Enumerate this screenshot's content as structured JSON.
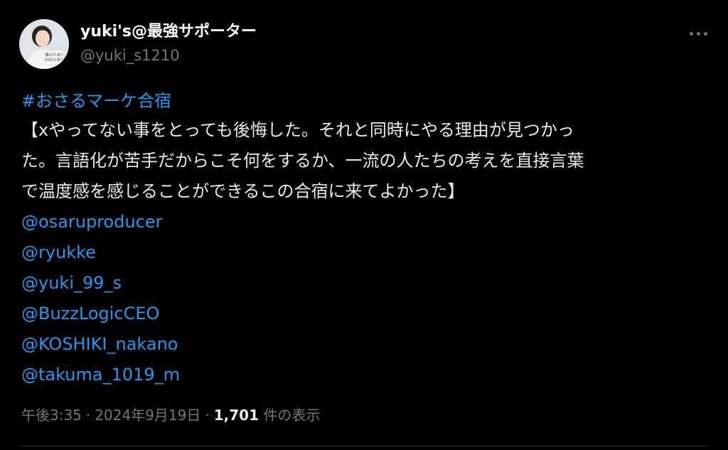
{
  "author": {
    "display_name": "yuki's@最強サポーター",
    "handle": "@yuki_s1210"
  },
  "avatar": {
    "caption_lines": [
      "誰のため?",
      "何のため?"
    ]
  },
  "tweet": {
    "hashtag": "#おさるマーケ合宿",
    "text_lines": [
      "【xやってない事をとっても後悔した。それと同時にやる理由が見つかっ",
      "た。言語化が苦手だからこそ何をするか、一流の人たちの考えを直接言葉",
      "で温度感を感じることができるこの合宿に来てよかった】"
    ],
    "mentions": [
      "@osaruproducer",
      "@ryukke",
      "@yuki_99_s",
      "@BuzzLogicCEO",
      "@KOSHIKI_nakano",
      "@takuma_1019_m"
    ]
  },
  "meta": {
    "time": "午後3:35",
    "separator": "·",
    "date": "2024年9月19日",
    "views_count": "1,701",
    "views_label": "件の表示"
  },
  "colors": {
    "background": "#000000",
    "link": "#1d9bf0",
    "text": "#e7e9ea",
    "muted": "#71767b"
  }
}
